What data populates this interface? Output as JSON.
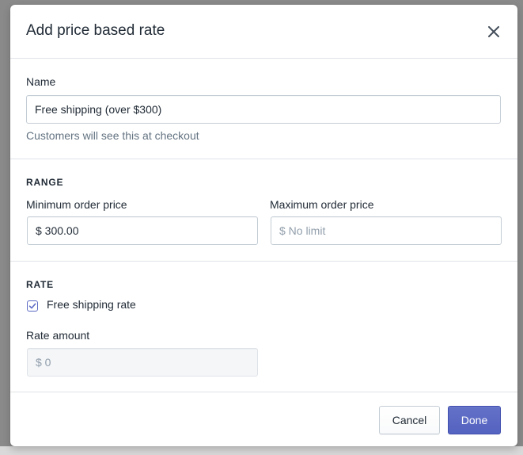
{
  "modal": {
    "title": "Add price based rate",
    "close_icon": "close-icon"
  },
  "name_section": {
    "label": "Name",
    "value": "Free shipping (over $300)",
    "help": "Customers will see this at checkout"
  },
  "range_section": {
    "heading": "RANGE",
    "min_label": "Minimum order price",
    "min_value": "$ 300.00",
    "max_label": "Maximum order price",
    "max_placeholder": "$ No limit"
  },
  "rate_section": {
    "heading": "RATE",
    "free_checkbox_label": "Free shipping rate",
    "free_checked": true,
    "amount_label": "Rate amount",
    "amount_placeholder": "$ 0"
  },
  "footer": {
    "cancel_label": "Cancel",
    "done_label": "Done"
  },
  "colors": {
    "primary": "#5c6ac4",
    "border": "#c4cdd5",
    "subdued_text": "#637381",
    "divider": "#dfe3e8"
  }
}
